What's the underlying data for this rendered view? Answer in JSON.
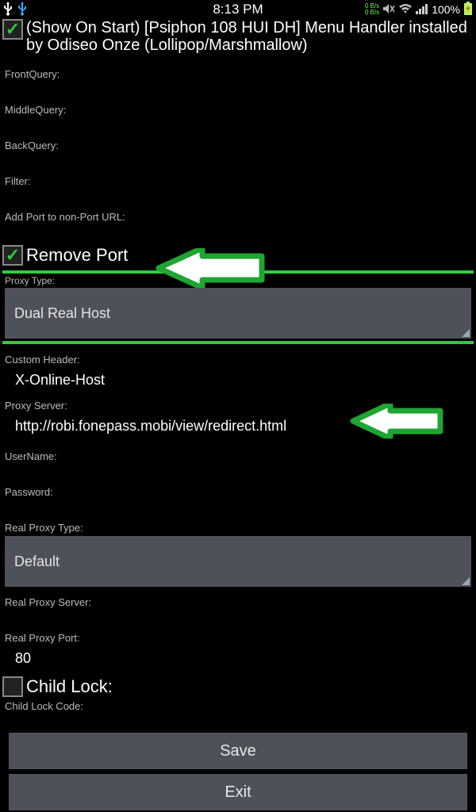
{
  "statusbar": {
    "time": "8:13 PM",
    "net_up": "0 B/s",
    "net_down": "0 B/s",
    "battery": "100%"
  },
  "header": {
    "title": "(Show On Start) [Psiphon 108 HUI DH] Menu Handler installed by Odiseo Onze (Lollipop/Marshmallow)"
  },
  "labels": {
    "front_query": "FrontQuery:",
    "middle_query": "MiddleQuery:",
    "back_query": "BackQuery:",
    "filter": "Filter:",
    "add_port": "Add Port to non-Port URL:",
    "remove_port": "Remove Port",
    "proxy_type": "Proxy Type:",
    "custom_header": "Custom Header:",
    "proxy_server": "Proxy Server:",
    "username": "UserName:",
    "password": "Password:",
    "real_proxy_type": "Real Proxy Type:",
    "real_proxy_server": "Real Proxy Server:",
    "real_proxy_port": "Real Proxy Port:",
    "child_lock": "Child Lock:",
    "child_lock_code": "Child Lock Code:"
  },
  "values": {
    "proxy_type": "Dual Real Host",
    "custom_header": "X-Online-Host",
    "proxy_server": "http://robi.fonepass.mobi/view/redirect.html",
    "real_proxy_type": "Default",
    "real_proxy_port": "80"
  },
  "buttons": {
    "save": "Save",
    "exit": "Exit"
  }
}
